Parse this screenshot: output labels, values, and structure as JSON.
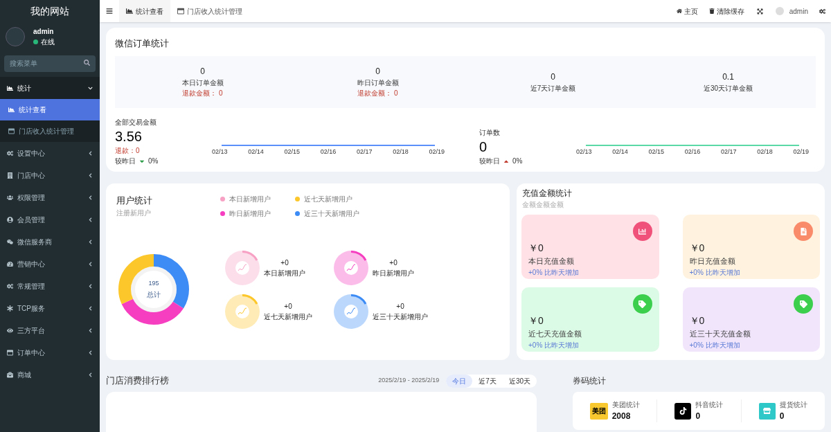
{
  "sidebar": {
    "title": "我的网站",
    "user": {
      "name": "admin",
      "status": "在线",
      "online": true
    },
    "search": {
      "placeholder": "搜索菜单"
    },
    "menu": [
      {
        "label": "统计",
        "expanded": true,
        "children": [
          {
            "label": "统计查看",
            "selected": true
          },
          {
            "label": "门店收入统计管理",
            "selected": false
          }
        ]
      },
      {
        "label": "设置中心",
        "expanded": false
      },
      {
        "label": "门店中心",
        "expanded": false
      },
      {
        "label": "权限管理",
        "expanded": false
      },
      {
        "label": "会员管理",
        "expanded": false
      },
      {
        "label": "微信服务商",
        "expanded": false
      },
      {
        "label": "营销中心",
        "expanded": false
      },
      {
        "label": "常规管理",
        "expanded": false
      },
      {
        "label": "TCP服务",
        "expanded": false
      },
      {
        "label": "三方平台",
        "expanded": false
      },
      {
        "label": "订单中心",
        "expanded": false
      },
      {
        "label": "商城",
        "expanded": false
      }
    ]
  },
  "header": {
    "tabs": [
      {
        "label": "统计查看",
        "selected": true
      },
      {
        "label": "门店收入统计管理",
        "selected": false
      }
    ],
    "actions": [
      {
        "label": "主页"
      },
      {
        "label": "清除缓存"
      }
    ],
    "user": "admin"
  },
  "wechat_orders": {
    "title": "微信订单统计",
    "stats": [
      {
        "value": "0",
        "label": "本日订单金额",
        "refund": "退款金额： 0"
      },
      {
        "value": "0",
        "label": "昨日订单金额",
        "refund": "退款金额： 0"
      },
      {
        "value": "0",
        "label": "近7天订单金额"
      },
      {
        "value": "0.1",
        "label": "近30天订单金额"
      }
    ],
    "panels": [
      {
        "label": "全部交易金额",
        "value": "3.56",
        "refund": "退款：0",
        "compare": "较昨日",
        "trend_up": false,
        "change": "0%",
        "color": "#5b8ff9",
        "x_labels": [
          "02/13",
          "02/14",
          "02/15",
          "02/16",
          "02/17",
          "02/18",
          "02/19"
        ]
      },
      {
        "label": "订单数",
        "value": "0",
        "compare": "较昨日",
        "trend_up": true,
        "change": "0%",
        "color": "#5ad8a6",
        "x_labels": [
          "02/13",
          "02/14",
          "02/15",
          "02/16",
          "02/17",
          "02/18",
          "02/19"
        ]
      }
    ]
  },
  "users": {
    "title": "用户统计",
    "subtitle": "注册新用户",
    "legend": [
      {
        "label": "本日新增用户",
        "color": "#f7a1c4"
      },
      {
        "label": "近七天新增用户",
        "color": "#fcc72b"
      },
      {
        "label": "昨日新增用户",
        "color": "#f53ec0"
      },
      {
        "label": "近三十天新增用户",
        "color": "#3d8bf5"
      }
    ],
    "donut": {
      "value": "195",
      "label": "总计"
    },
    "rings": [
      {
        "value": "+0",
        "label": "本日新增用户",
        "color": "#f7a1c4"
      },
      {
        "value": "+0",
        "label": "昨日新增用户",
        "color": "#f53ec0"
      },
      {
        "value": "+0",
        "label": "近七天新增用户",
        "color": "#fcc72b"
      },
      {
        "value": "+0",
        "label": "近三十天新增用户",
        "color": "#3d8bf5"
      }
    ]
  },
  "recharge": {
    "title": "充值金额统计",
    "subtitle": "金额金额金额",
    "cards": [
      {
        "amount": "￥0",
        "label": "本日充值金额",
        "note": "+0% 比昨天增加",
        "color": "#ffe1e6",
        "kind": "chart"
      },
      {
        "amount": "￥0",
        "label": "昨日充值金额",
        "note": "+0% 比昨天增加",
        "color": "#fff3df",
        "kind": "document"
      },
      {
        "amount": "￥0",
        "label": "近七天充值金额",
        "note": "+0% 比昨天增加",
        "color": "#dcfbe6",
        "kind": "tag"
      },
      {
        "amount": "￥0",
        "label": "近三十天充值金额",
        "note": "+0% 比昨天增加",
        "color": "#f1e5fc",
        "kind": "tag"
      }
    ]
  },
  "ranking": {
    "title": "门店消费排行榜",
    "date_range": "2025/2/19 - 2025/2/19",
    "tabs": [
      {
        "label": "今日",
        "selected": true
      },
      {
        "label": "近7天",
        "selected": false
      },
      {
        "label": "近30天",
        "selected": false
      }
    ]
  },
  "coupons": {
    "title": "券码统计",
    "items": [
      {
        "kind": "meituan",
        "logo_text": "美团",
        "label": "美团统计",
        "value": "2008"
      },
      {
        "kind": "douyin",
        "label": "抖音统计",
        "value": "0"
      },
      {
        "kind": "store",
        "label": "提货统计",
        "value": "0"
      }
    ]
  }
}
